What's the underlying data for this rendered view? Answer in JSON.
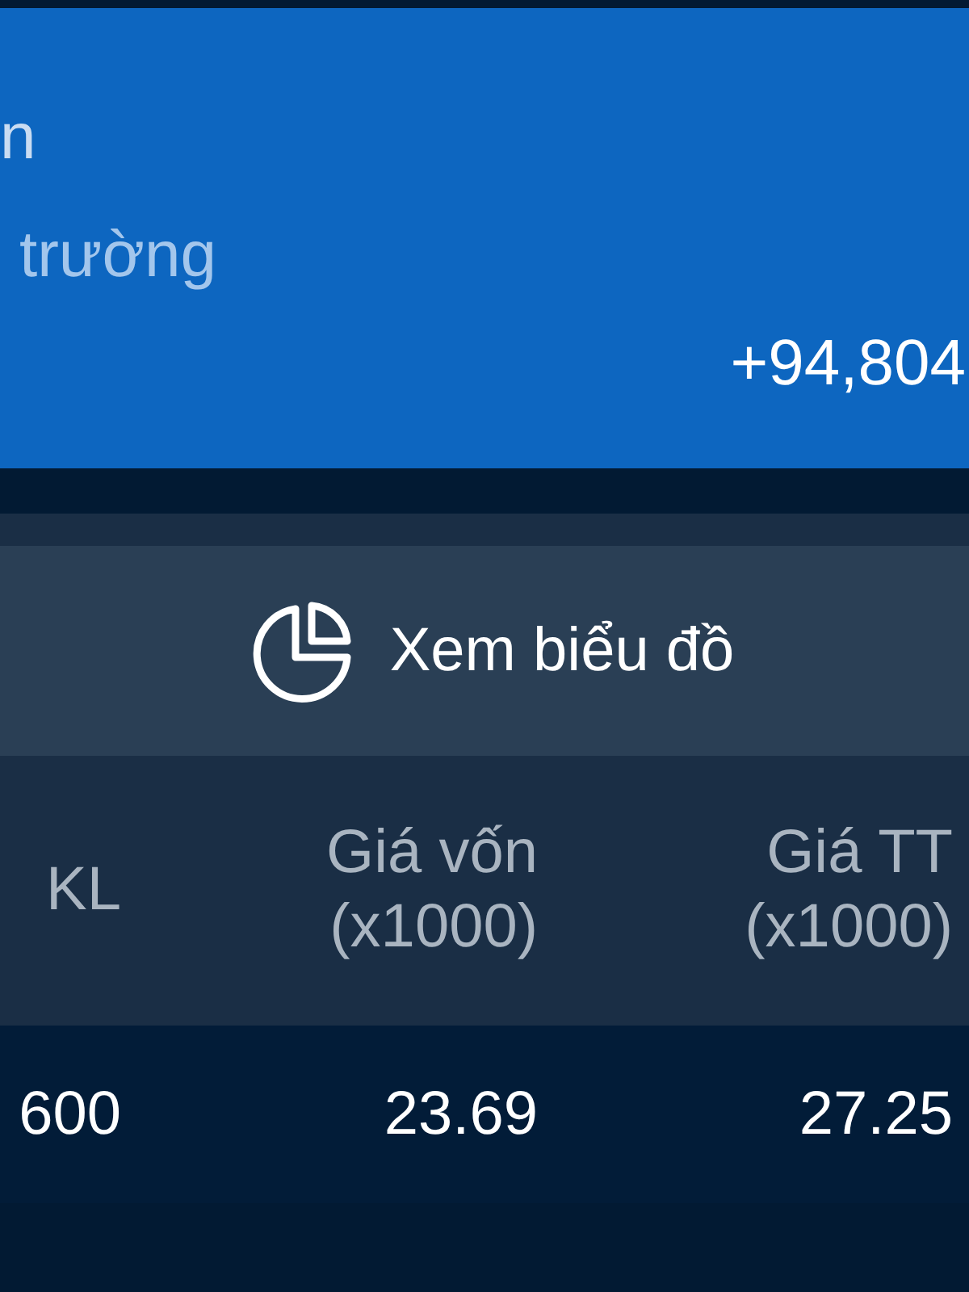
{
  "summary_card": {
    "line_1": "n",
    "line_2": "trường",
    "value": "+94,804"
  },
  "chart_button": {
    "label": "Xem biểu đồ"
  },
  "table": {
    "columns": [
      {
        "lines": [
          "KL"
        ]
      },
      {
        "lines": [
          "Giá vốn",
          "(x1000)"
        ]
      },
      {
        "lines": [
          "Giá TT",
          "(x1000)"
        ]
      }
    ],
    "rows": [
      [
        "600",
        "23.69",
        "27.25"
      ]
    ]
  }
}
